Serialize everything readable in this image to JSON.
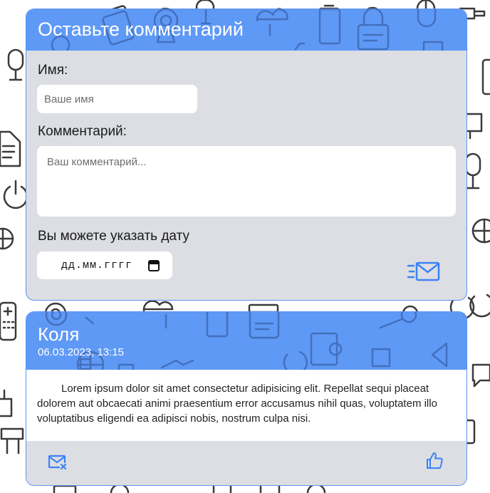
{
  "colors": {
    "accent": "#5f99f6",
    "panel": "#dcdee3",
    "pattern": "#3a3a3a"
  },
  "form": {
    "title": "Оставьте комментарий",
    "name_label": "Имя:",
    "name_placeholder": "Ваше имя",
    "comment_label": "Комментарий:",
    "comment_placeholder": "Ваш комментарий...",
    "date_label": "Вы можете указать дату",
    "date_placeholder": "дд.мм.гггг",
    "send_icon": "send-mail-icon"
  },
  "comments": [
    {
      "author": "Коля",
      "date": "06.03.2023, 13:15",
      "text": "Lorem ipsum dolor sit amet consectetur adipisicing elit. Repellat sequi placeat dolorem aut obcaecati animi praesentium error accusamus nihil quas, voluptatem illo voluptatibus eligendi ea adipisci nobis, nostrum culpa nisi.",
      "delete_icon": "mail-delete-icon",
      "like_icon": "thumbs-up-icon"
    }
  ]
}
